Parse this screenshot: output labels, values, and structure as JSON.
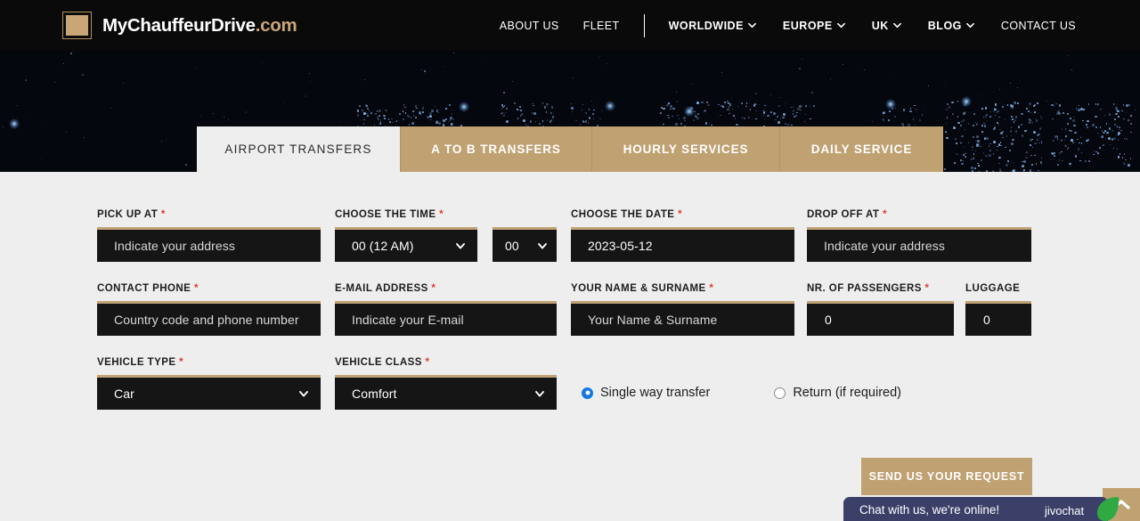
{
  "header": {
    "logo": {
      "mark": "square-logo-icon",
      "text_white": "MyChauffeurDrive",
      "text_accent": ".com"
    },
    "nav": [
      {
        "label": "ABOUT US",
        "has_caret": false,
        "bold": false
      },
      {
        "label": "FLEET",
        "has_caret": false,
        "bold": false
      },
      {
        "label": "WORLDWIDE",
        "has_caret": true,
        "bold": true
      },
      {
        "label": "EUROPE",
        "has_caret": true,
        "bold": true
      },
      {
        "label": "UK",
        "has_caret": true,
        "bold": true
      },
      {
        "label": "BLOG",
        "has_caret": true,
        "bold": true
      },
      {
        "label": "CONTACT US",
        "has_caret": false,
        "bold": false
      }
    ]
  },
  "tabs": [
    {
      "label": "AIRPORT TRANSFERS",
      "active": true
    },
    {
      "label": "A TO B TRANSFERS",
      "active": false
    },
    {
      "label": "HOURLY SERVICES",
      "active": false
    },
    {
      "label": "DAILY SERVICE",
      "active": false
    }
  ],
  "form": {
    "pickup": {
      "label": "PICK UP AT",
      "required": true,
      "placeholder": "Indicate your address",
      "value": ""
    },
    "time": {
      "label": "CHOOSE THE TIME",
      "required": true,
      "hour": "00 (12 AM)",
      "minute": "00"
    },
    "date": {
      "label": "CHOOSE THE DATE",
      "required": true,
      "value": "2023-05-12"
    },
    "dropoff": {
      "label": "DROP OFF AT",
      "required": true,
      "placeholder": "Indicate your address",
      "value": ""
    },
    "phone": {
      "label": "CONTACT PHONE",
      "required": true,
      "placeholder": "Country code and phone number",
      "value": ""
    },
    "email": {
      "label": "E-MAIL ADDRESS",
      "required": true,
      "placeholder": "Indicate your E-mail",
      "value": ""
    },
    "name": {
      "label": "YOUR NAME & SURNAME",
      "required": true,
      "placeholder": "Your Name & Surname",
      "value": ""
    },
    "passengers": {
      "label": "NR. OF PASSENGERS",
      "required": true,
      "value": "0"
    },
    "luggage": {
      "label": "LUGGAGE",
      "required": false,
      "value": "0"
    },
    "vehicle_type": {
      "label": "VEHICLE TYPE",
      "required": true,
      "value": "Car"
    },
    "vehicle_class": {
      "label": "VEHICLE CLASS",
      "required": true,
      "value": "Comfort"
    },
    "trip_type": {
      "options": [
        {
          "label": "Single way transfer",
          "selected": true
        },
        {
          "label": "Return (if required)",
          "selected": false
        }
      ]
    },
    "submit_label": "SEND US YOUR REQUEST"
  },
  "chat": {
    "message": "Chat with us, we're online!",
    "brand": "jivochat"
  },
  "scroll_top": {
    "icon": "chevron-up-icon"
  },
  "colors": {
    "accent": "#c0a172",
    "field_bg": "#151515",
    "page_bg": "#eeeeee",
    "header_bg": "#0a0a0a",
    "chat_bg": "#3c4068",
    "required": "#e23b2e"
  }
}
